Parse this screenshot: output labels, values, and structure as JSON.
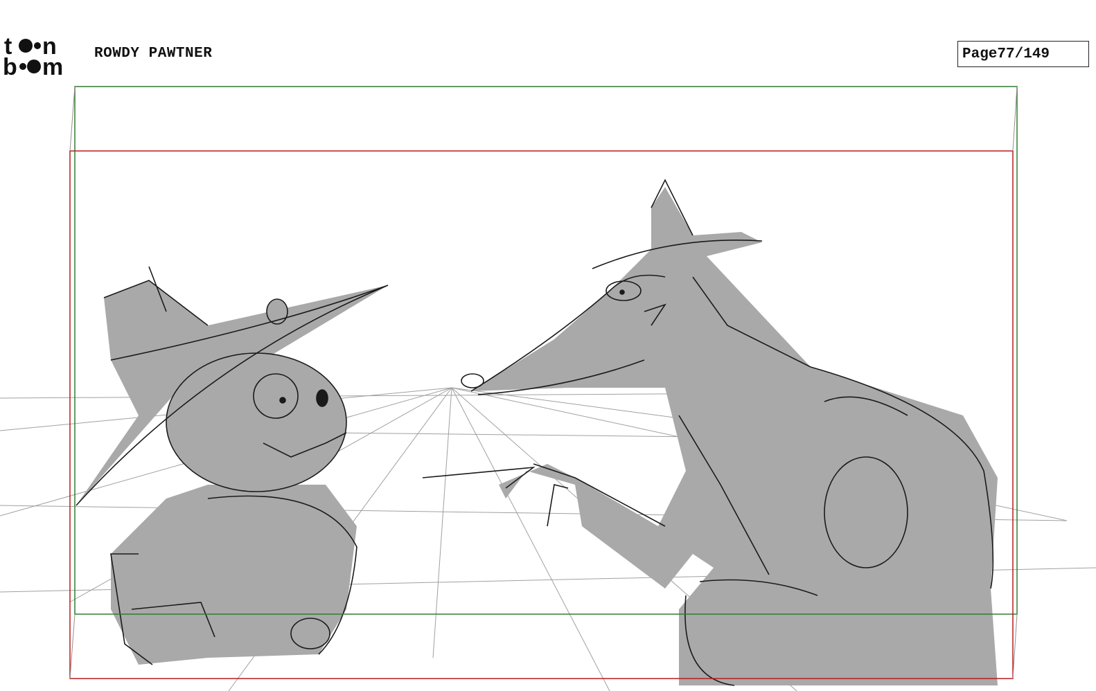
{
  "header": {
    "logo_text": "toon boom",
    "project_title": "ROWDY PAWTNER",
    "page_label": "Page",
    "page_number": "77/149"
  },
  "colors": {
    "safe_frame": "#2e7d32",
    "camera_frame": "#b71c1c",
    "sketch_fill": "#a9a9a9",
    "sketch_line": "#1a1a1a",
    "perspective_line": "#9e9e9e"
  }
}
